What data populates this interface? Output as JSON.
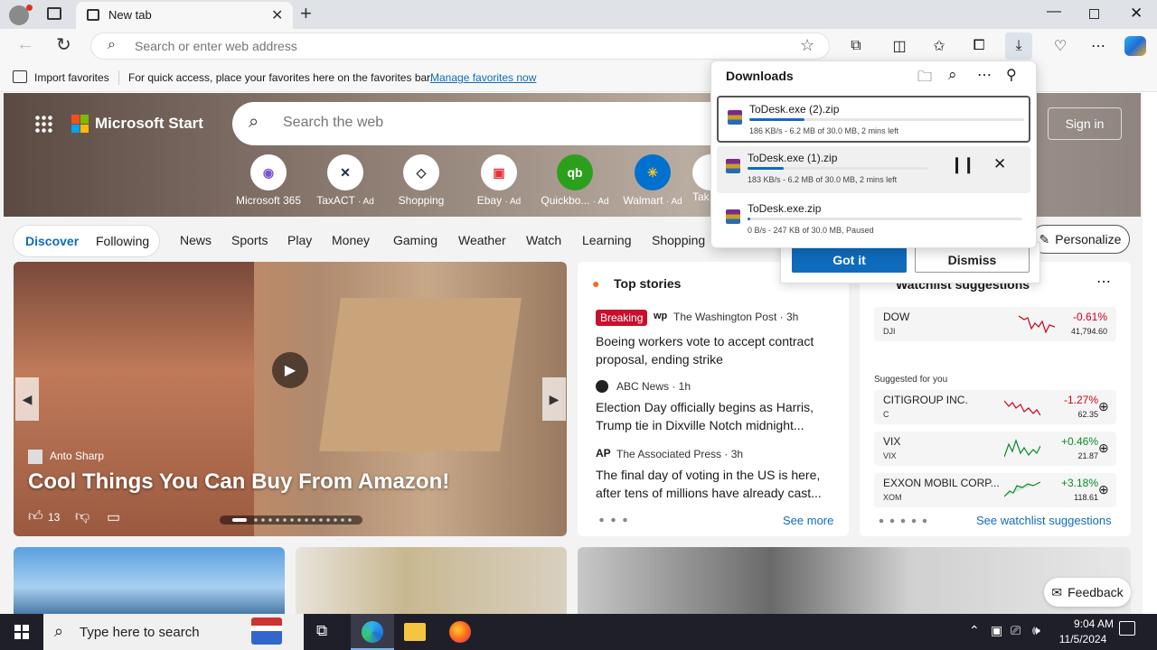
{
  "browser": {
    "tab_title": "New tab",
    "address_placeholder": "Search or enter web address"
  },
  "favorites_bar": {
    "import_label": "Import favorites",
    "message": "For quick access, place your favorites here on the favorites bar.",
    "manage_link": "Manage favorites now"
  },
  "downloads": {
    "title": "Downloads",
    "items": [
      {
        "filename": "ToDesk.exe (2).zip",
        "status": "186 KB/s - 6.2 MB of 30.0 MB, 2 mins left",
        "progress": 0.2
      },
      {
        "filename": "ToDesk.exe (1).zip",
        "status": "183 KB/s - 6.2 MB of 30.0 MB, 2 mins left",
        "progress": 0.2
      },
      {
        "filename": "ToDesk.exe.zip",
        "status": "0 B/s - 247 KB of 30.0 MB, Paused",
        "progress": 0.01
      }
    ],
    "got_it": "Got it",
    "dismiss": "Dismiss"
  },
  "start": {
    "brand": "Microsoft Start",
    "search_placeholder": "Search the web",
    "sign_in": "Sign in",
    "apps": [
      {
        "label": "Microsoft 365",
        "ad": ""
      },
      {
        "label": "TaxACT",
        "ad": "· Ad"
      },
      {
        "label": "Shopping",
        "ad": ""
      },
      {
        "label": "Ebay",
        "ad": "· Ad"
      },
      {
        "label": "Quickbo...",
        "ad": "· Ad"
      },
      {
        "label": "Walmart",
        "ad": "· Ad"
      },
      {
        "label": "Tak",
        "ad": ""
      }
    ]
  },
  "nav": {
    "discover": "Discover",
    "following": "Following",
    "items": [
      "News",
      "Sports",
      "Play",
      "Money",
      "Gaming",
      "Weather",
      "Watch",
      "Learning",
      "Shopping"
    ],
    "personalize": "Personalize"
  },
  "hero_story": {
    "author": "Anto Sharp",
    "title": "Cool Things You Can Buy From Amazon!",
    "likes": "13"
  },
  "top_stories": {
    "heading": "Top stories",
    "stories": [
      {
        "badge": "Breaking",
        "publisher": "The Washington Post · 3h",
        "headline": "Boeing workers vote to accept contract proposal, ending strike"
      },
      {
        "badge": "",
        "publisher": "ABC News · 1h",
        "headline": "Election Day officially begins as Harris, Trump tie in Dixville Notch midnight..."
      },
      {
        "badge": "",
        "publisher": "The Associated Press · 3h",
        "headline": "The final day of voting in the US is here, after tens of millions have already cast..."
      }
    ],
    "see_more": "See more"
  },
  "watchlist": {
    "heading": "Watchlist suggestions",
    "suggested_label": "Suggested for you",
    "see_link": "See watchlist suggestions",
    "stocks": [
      {
        "name": "DOW",
        "symbol": "DJI",
        "change": "-0.61%",
        "value": "41,794.60",
        "direction": "down"
      },
      {
        "name": "CITIGROUP INC.",
        "symbol": "C",
        "change": "-1.27%",
        "value": "62.35",
        "direction": "down"
      },
      {
        "name": "VIX",
        "symbol": "VIX",
        "change": "+0.46%",
        "value": "21.87",
        "direction": "up"
      },
      {
        "name": "EXXON MOBIL CORP...",
        "symbol": "XOM",
        "change": "+3.18%",
        "value": "118.61",
        "direction": "up"
      }
    ]
  },
  "feedback": "Feedback",
  "taskbar": {
    "search_placeholder": "Type here to search",
    "time": "9:04 AM",
    "date": "11/5/2024"
  },
  "colors": {
    "accent": "#0f6cbd",
    "up": "#0a8a2a",
    "down": "#d0021b"
  }
}
